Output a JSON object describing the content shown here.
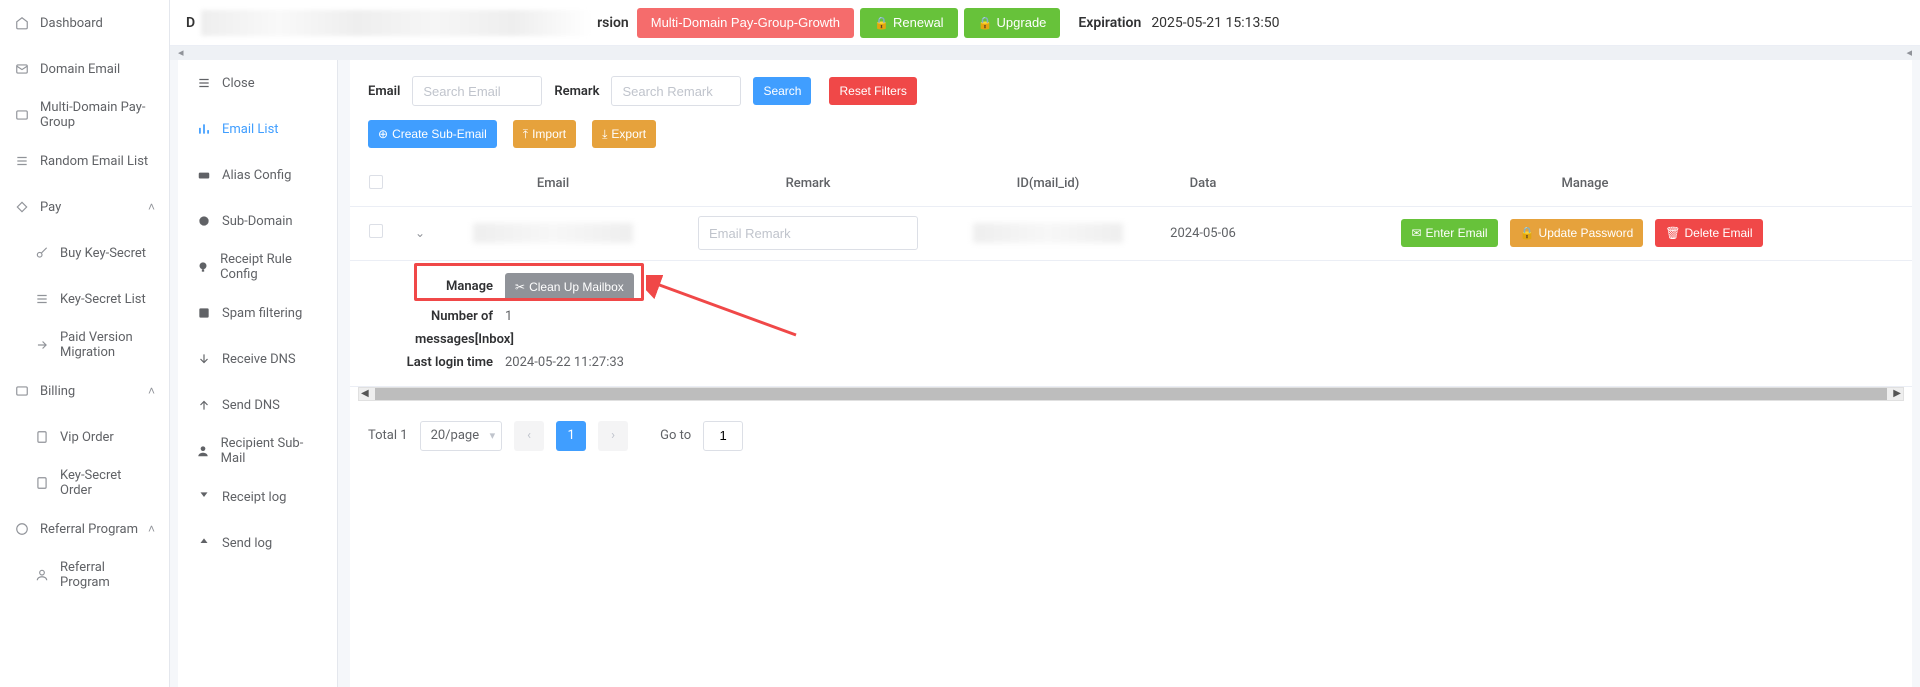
{
  "mainSidebar": {
    "items": [
      {
        "label": "Dashboard"
      },
      {
        "label": "Domain Email"
      },
      {
        "label": "Multi-Domain Pay-Group"
      },
      {
        "label": "Random Email List"
      },
      {
        "label": "Pay",
        "chev": "˄"
      },
      {
        "label": "Buy Key-Secret",
        "sub": true
      },
      {
        "label": "Key-Secret List",
        "sub": true
      },
      {
        "label": "Paid Version Migration",
        "sub": true
      },
      {
        "label": "Billing",
        "chev": "˄"
      },
      {
        "label": "Vip Order",
        "sub": true
      },
      {
        "label": "Key-Secret Order",
        "sub": true
      },
      {
        "label": "Referral Program",
        "chev": "˄"
      },
      {
        "label": "Referral Program",
        "sub": true
      }
    ]
  },
  "topBar": {
    "leftD": "D",
    "rsion": "rsion",
    "multiDomain": "Multi-Domain Pay-Group-Growth",
    "renewal": "Renewal",
    "upgrade": "Upgrade",
    "expiration_label": "Expiration",
    "expiration_value": "2025-05-21 15:13:50"
  },
  "subSidebar": {
    "close": "Close",
    "emailList": "Email List",
    "aliasConfig": "Alias Config",
    "subDomain": "Sub-Domain",
    "receiptRule": "Receipt Rule Config",
    "spamFiltering": "Spam filtering",
    "receiveDNS": "Receive DNS",
    "sendDNS": "Send DNS",
    "recipientSubMail": "Recipient Sub-Mail",
    "receiptLog": "Receipt log",
    "sendLog": "Send log"
  },
  "filters": {
    "email_label": "Email",
    "email_placeholder": "Search Email",
    "remark_label": "Remark",
    "remark_placeholder": "Search Remark",
    "search": "Search",
    "reset": "Reset Filters"
  },
  "actions": {
    "create": "Create Sub-Email",
    "import": "Import",
    "export": "Export"
  },
  "table": {
    "headers": {
      "email": "Email",
      "remark": "Remark",
      "id": "ID(mail_id)",
      "data": "Data",
      "manage": "Manage"
    },
    "row": {
      "remark_placeholder": "Email Remark",
      "date": "2024-05-06",
      "enter_email": "Enter Email",
      "update_password": "Update Password",
      "delete_email": "Delete Email"
    },
    "expanded": {
      "manage_label": "Manage",
      "clean_up": "Clean Up Mailbox",
      "num_messages_label": "Number of messages[Inbox]",
      "num_messages_value": "1",
      "last_login_label": "Last login time",
      "last_login_value": "2024-05-22 11:27:33"
    }
  },
  "pagination": {
    "total_label": "Total 1",
    "per_page": "20/page",
    "current": "1",
    "goto_label": "Go to",
    "goto_value": "1"
  }
}
